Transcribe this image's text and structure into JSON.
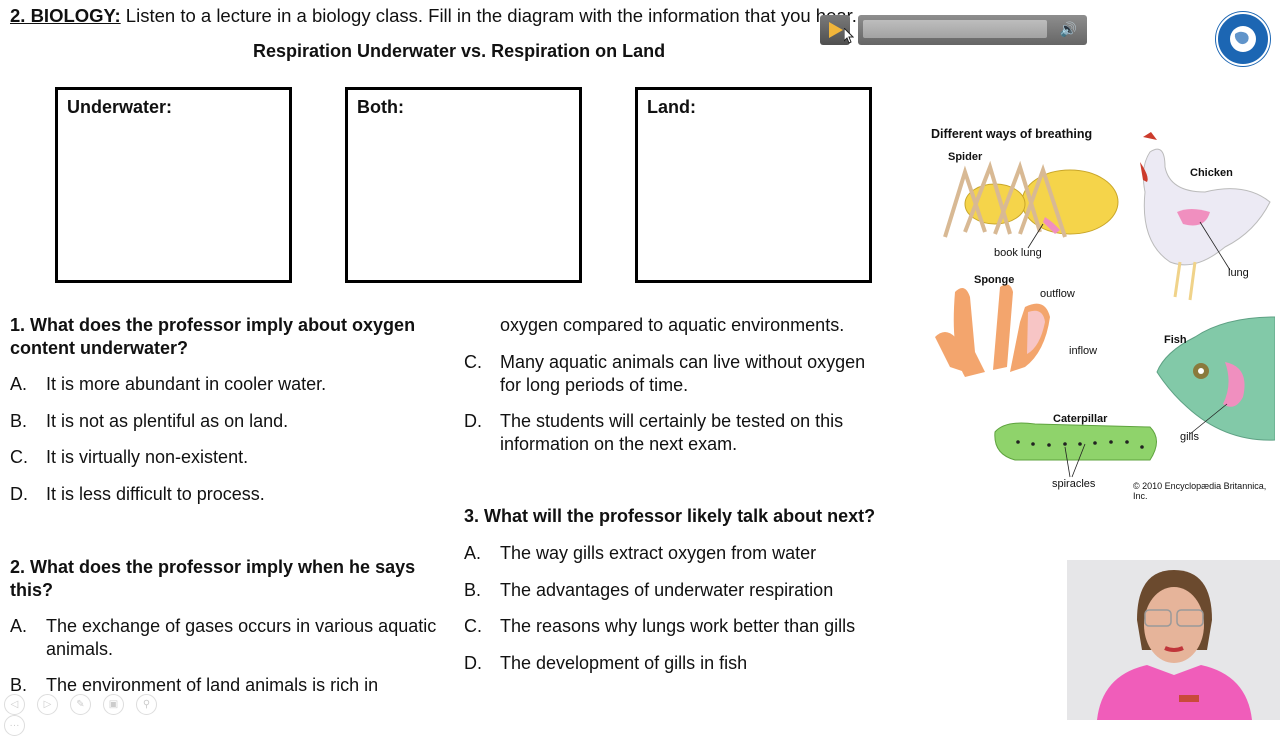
{
  "header": {
    "tag": "2. BIOLOGY:",
    "instruction": " Listen to a lecture in a biology class. Fill in the diagram with the information that you hear."
  },
  "subtitle": "Respiration Underwater vs. Respiration on Land",
  "boxes": [
    {
      "label": "Underwater:"
    },
    {
      "label": "Both:"
    },
    {
      "label": "Land:"
    }
  ],
  "questions": [
    {
      "number_text": "1. What does the professor imply about oxygen",
      "number_text2": "content underwater?",
      "options": [
        {
          "letter": "A.",
          "text": "It is more abundant in cooler water."
        },
        {
          "letter": "B.",
          "text": "It is not as plentiful as on land."
        },
        {
          "letter": "C.",
          "text": "It is virtually non-existent."
        },
        {
          "letter": "D.",
          "text": "It is less difficult to process."
        }
      ]
    },
    {
      "number_text": "2. What does the professor imply when he says",
      "number_text2": "this?",
      "options": [
        {
          "letter": "A.",
          "text": "The exchange of gases occurs in various aquatic",
          "text2": "animals."
        },
        {
          "letter": "B.",
          "text": "The environment of land animals is rich in",
          "text2": "oxygen compared to aquatic environments."
        },
        {
          "letter": "C.",
          "text": "Many aquatic animals can live without oxygen",
          "text2": "for long periods of time."
        },
        {
          "letter": "D.",
          "text": "The students will certainly be tested on this",
          "text2": "information on the next exam."
        }
      ]
    },
    {
      "number_text": "3. What will the professor likely talk about next?",
      "options": [
        {
          "letter": "A.",
          "text": "The way gills extract oxygen from water"
        },
        {
          "letter": "B.",
          "text": "The advantages of underwater respiration"
        },
        {
          "letter": "C.",
          "text": "The reasons why lungs work better than gills"
        },
        {
          "letter": "D.",
          "text": "The development of gills in fish"
        }
      ]
    }
  ],
  "diagram": {
    "title": "Different ways of breathing",
    "labels": {
      "spider": "Spider",
      "book_lung": "book lung",
      "chicken": "Chicken",
      "lung": "lung",
      "sponge": "Sponge",
      "outflow": "outflow",
      "inflow": "inflow",
      "fish": "Fish",
      "gills": "gills",
      "caterpillar": "Caterpillar",
      "spiracles": "spiracles"
    },
    "copyright": "© 2010 Encyclopædia Britannica, Inc."
  },
  "player": {
    "play_icon": "play-icon",
    "volume_icon": "volume-icon",
    "volume_glyph": "🔊"
  },
  "nav": {
    "buttons": [
      "◁",
      "▷",
      "✎",
      "▣",
      "⚲",
      "···"
    ]
  }
}
